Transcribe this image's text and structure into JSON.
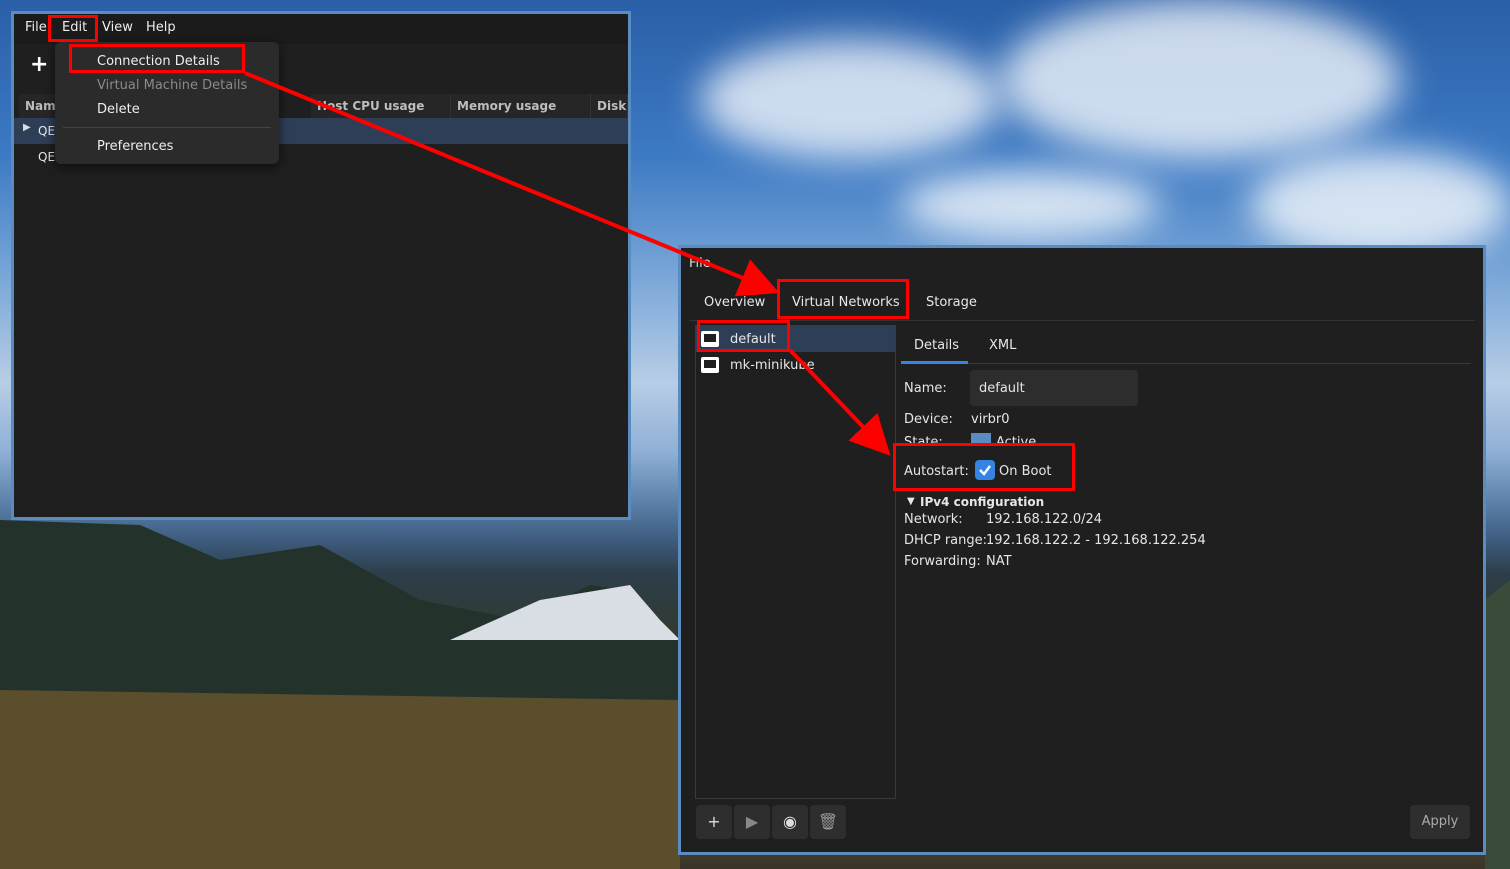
{
  "main_window": {
    "menu": [
      "File",
      "Edit",
      "View",
      "Help"
    ],
    "columns": [
      "Name",
      "Host CPU usage",
      "Memory usage",
      "Disk I"
    ],
    "rows": [
      "QE",
      "QE"
    ],
    "edit_menu": {
      "items": [
        "Connection Details",
        "Virtual Machine Details",
        "Delete",
        "Preferences"
      ]
    }
  },
  "details_window": {
    "menu_partial": "File",
    "tabs": [
      "Overview",
      "Virtual Networks",
      "Storage"
    ],
    "networks": [
      "default",
      "mk-minikube"
    ],
    "subtabs": [
      "Details",
      "XML"
    ],
    "name_label": "Name:",
    "name_value": "default",
    "device_label": "Device:",
    "device_value": "virbr0",
    "state_label": "State:",
    "state_value": "Active",
    "autostart_label": "Autostart:",
    "autostart_value": "On Boot",
    "ipv4_header": "IPv4 configuration",
    "network_label": "Network:",
    "network_value": "192.168.122.0/24",
    "dhcp_label": "DHCP range:",
    "dhcp_value": "192.168.122.2 - 192.168.122.254",
    "forwarding_label": "Forwarding:",
    "forwarding_value": "NAT",
    "apply_label": "Apply"
  },
  "colors": {
    "accent_red": "#ff0000",
    "window_border": "#5b8cc0",
    "selection": "#2e3e57",
    "checkbox": "#3584e4"
  }
}
